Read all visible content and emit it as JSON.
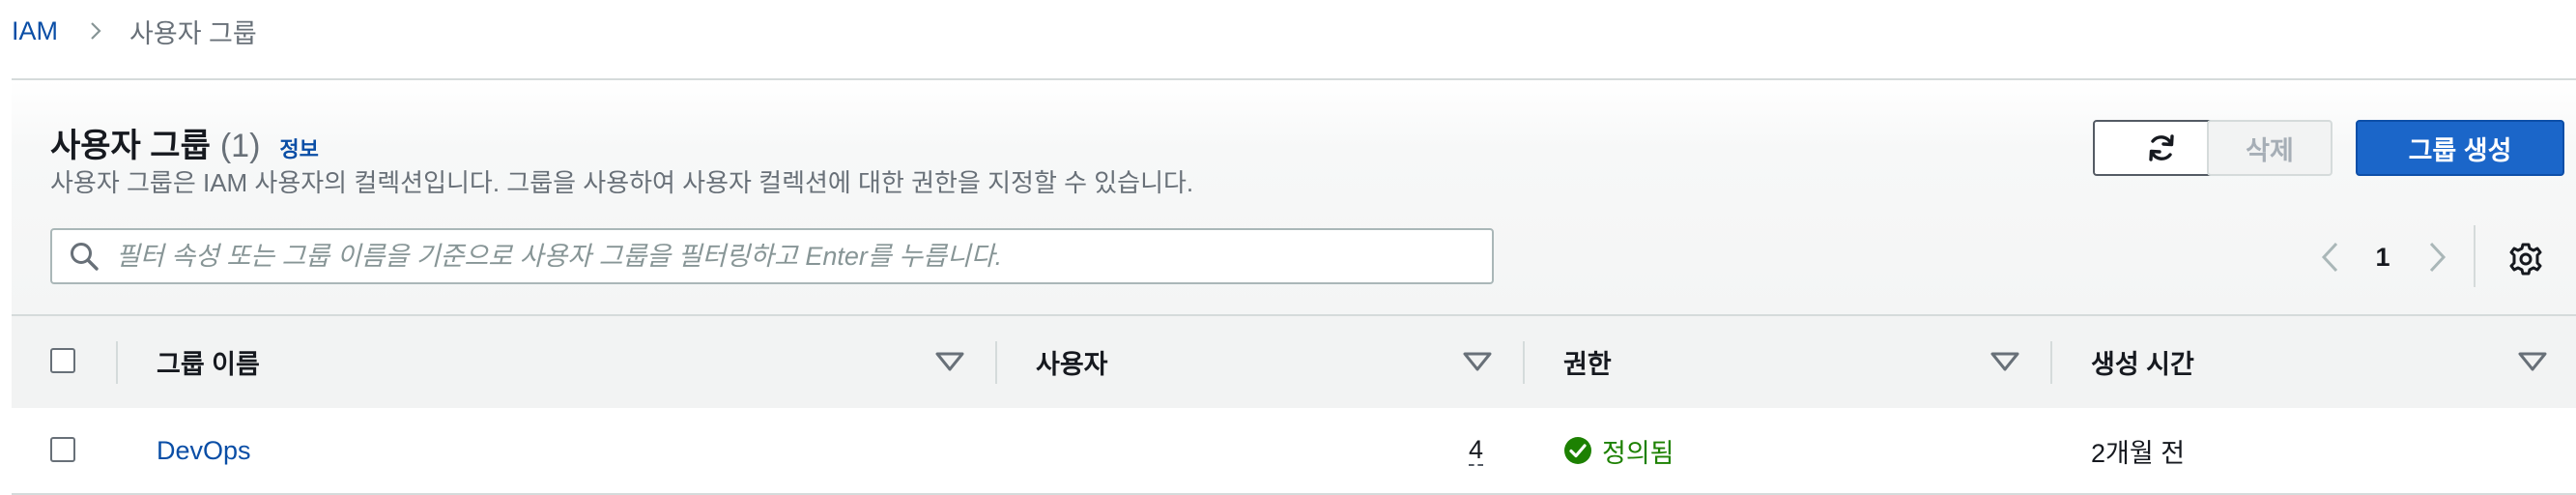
{
  "breadcrumb": {
    "root": "IAM",
    "current": "사용자 그룹"
  },
  "header": {
    "title": "사용자 그룹",
    "count": "(1)",
    "info": "정보",
    "description": "사용자 그룹은 IAM 사용자의 컬렉션입니다. 그룹을 사용하여 사용자 컬렉션에 대한 권한을 지정할 수 있습니다."
  },
  "actions": {
    "delete_label": "삭제",
    "create_label": "그룹 생성",
    "refresh_icon": "refresh-icon"
  },
  "search": {
    "placeholder": "필터 속성 또는 그룹 이름을 기준으로 사용자 그룹을 필터링하고 Enter를 누릅니다.",
    "value": ""
  },
  "pagination": {
    "current_page": "1"
  },
  "table": {
    "columns": [
      "그룹 이름",
      "사용자",
      "권한",
      "생성 시간"
    ],
    "rows": [
      {
        "name": "DevOps",
        "users": "4",
        "permissions": "정의됨",
        "created": "2개월 전"
      }
    ]
  },
  "colors": {
    "link": "#0a4ea6",
    "primary_button": "#1b66c9",
    "success": "#1d8102",
    "muted_text": "#687078"
  }
}
